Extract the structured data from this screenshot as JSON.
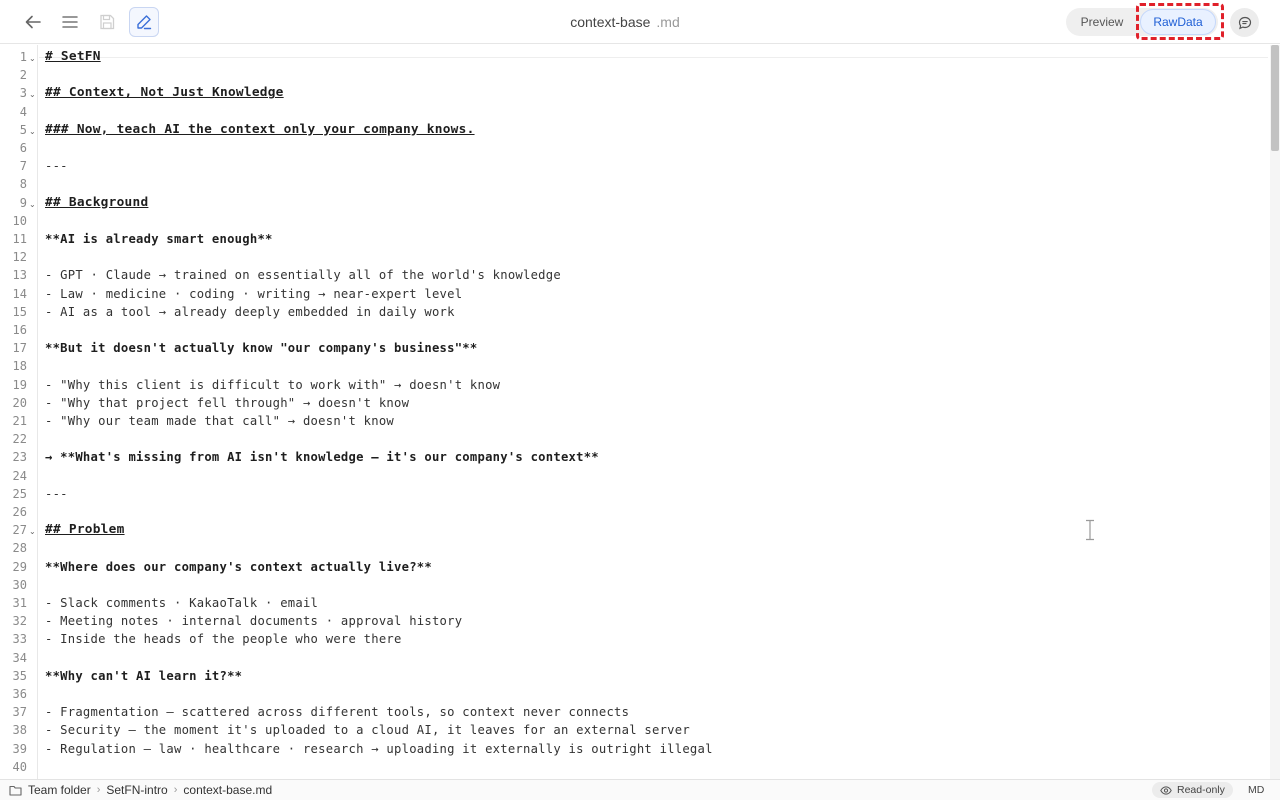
{
  "toolbar": {
    "title": "context-base",
    "extension": ".md",
    "view_modes": [
      "Preview",
      "RawData"
    ],
    "active_mode": "RawData"
  },
  "editor": {
    "lines": [
      {
        "n": "1",
        "text": "# SetFN",
        "style": "h",
        "fold": true
      },
      {
        "n": "2",
        "text": "",
        "style": ""
      },
      {
        "n": "3",
        "text": "## Context, Not Just Knowledge",
        "style": "h",
        "fold": true
      },
      {
        "n": "4",
        "text": "",
        "style": ""
      },
      {
        "n": "5",
        "text": "### Now, teach AI the context only your company knows.",
        "style": "h",
        "fold": true
      },
      {
        "n": "6",
        "text": "",
        "style": ""
      },
      {
        "n": "7",
        "text": "---",
        "style": "r"
      },
      {
        "n": "8",
        "text": "",
        "style": ""
      },
      {
        "n": "9",
        "text": "## Background",
        "style": "h",
        "fold": true
      },
      {
        "n": "10",
        "text": "",
        "style": ""
      },
      {
        "n": "11",
        "text": "**AI is already smart enough**",
        "style": "b"
      },
      {
        "n": "12",
        "text": "",
        "style": ""
      },
      {
        "n": "13",
        "text": "- GPT · Claude → trained on essentially all of the world's knowledge",
        "style": "r"
      },
      {
        "n": "14",
        "text": "- Law · medicine · coding · writing → near-expert level",
        "style": "r"
      },
      {
        "n": "15",
        "text": "- AI as a tool → already deeply embedded in daily work",
        "style": "r"
      },
      {
        "n": "16",
        "text": "",
        "style": ""
      },
      {
        "n": "17",
        "text": "**But it doesn't actually know \"our company's business\"**",
        "style": "b"
      },
      {
        "n": "18",
        "text": "",
        "style": ""
      },
      {
        "n": "19",
        "text": "- \"Why this client is difficult to work with\" → doesn't know",
        "style": "r"
      },
      {
        "n": "20",
        "text": "- \"Why that project fell through\" → doesn't know",
        "style": "r"
      },
      {
        "n": "21",
        "text": "- \"Why our team made that call\" → doesn't know",
        "style": "r"
      },
      {
        "n": "22",
        "text": "",
        "style": ""
      },
      {
        "n": "23",
        "text": "→ **What's missing from AI isn't knowledge — it's our company's context**",
        "style": "b"
      },
      {
        "n": "24",
        "text": "",
        "style": ""
      },
      {
        "n": "25",
        "text": "---",
        "style": "r"
      },
      {
        "n": "26",
        "text": "",
        "style": ""
      },
      {
        "n": "27",
        "text": "## Problem",
        "style": "h",
        "fold": true
      },
      {
        "n": "28",
        "text": "",
        "style": ""
      },
      {
        "n": "29",
        "text": "**Where does our company's context actually live?**",
        "style": "b"
      },
      {
        "n": "30",
        "text": "",
        "style": ""
      },
      {
        "n": "31",
        "text": "- Slack comments · KakaoTalk · email",
        "style": "r"
      },
      {
        "n": "32",
        "text": "- Meeting notes · internal documents · approval history",
        "style": "r"
      },
      {
        "n": "33",
        "text": "- Inside the heads of the people who were there",
        "style": "r"
      },
      {
        "n": "34",
        "text": "",
        "style": ""
      },
      {
        "n": "35",
        "text": "**Why can't AI learn it?**",
        "style": "b"
      },
      {
        "n": "36",
        "text": "",
        "style": ""
      },
      {
        "n": "37",
        "text": "- Fragmentation — scattered across different tools, so context never connects",
        "style": "r"
      },
      {
        "n": "38",
        "text": "- Security — the moment it's uploaded to a cloud AI, it leaves for an external server",
        "style": "r"
      },
      {
        "n": "39",
        "text": "- Regulation — law · healthcare · research → uploading it externally is outright illegal",
        "style": "r"
      },
      {
        "n": "40",
        "text": "",
        "style": ""
      }
    ]
  },
  "statusbar": {
    "breadcrumb": [
      "Team folder",
      "SetFN-intro",
      "context-base.md"
    ],
    "mode_badge": "Read-only",
    "file_type": "MD"
  },
  "icons": {
    "back": "arrow-left-icon",
    "menu": "hamburger-menu-icon",
    "save": "save-disk-icon",
    "edit": "pencil-edit-icon",
    "comment": "comment-bubble-icon",
    "folder": "folder-icon",
    "eye": "eye-icon"
  },
  "colors": {
    "accent": "#1f5fd6",
    "highlight": "#e0202a"
  }
}
